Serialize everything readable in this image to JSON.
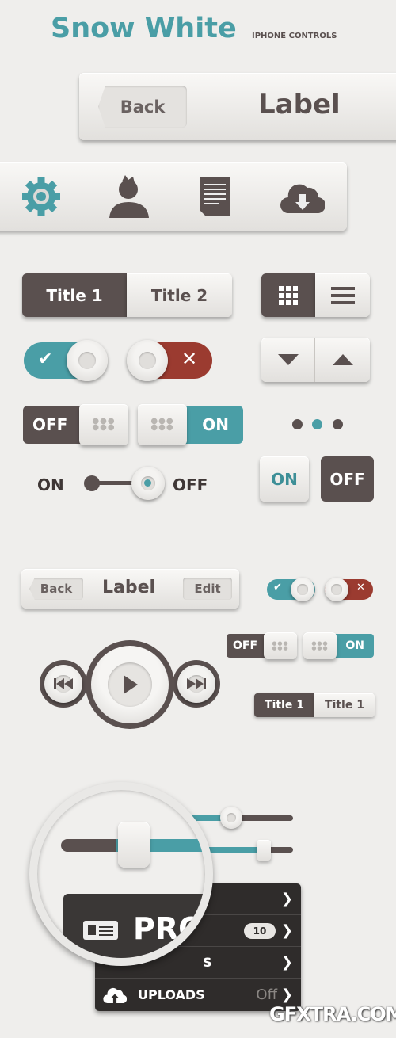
{
  "header": {
    "title": "Snow White",
    "subtitle": "IPHONE CONTROLS"
  },
  "colors": {
    "accent": "#4a9ea6",
    "dark": "#5a504f",
    "danger": "#9b3b30",
    "background": "#efeeec"
  },
  "navbar": {
    "back": "Back",
    "label": "Label"
  },
  "tabbar": {
    "icons": [
      "gear-icon",
      "user-icon",
      "document-icon",
      "cloud-download-icon"
    ]
  },
  "segmented": {
    "items": [
      "Title 1",
      "Title 2"
    ],
    "selected": 0
  },
  "view_toggle": {
    "icons": [
      "grid-icon",
      "list-icon"
    ],
    "selected": 0
  },
  "switches": {
    "off": "OFF",
    "on": "ON"
  },
  "page_dots": {
    "count": 3,
    "active": 1
  },
  "slider_switch": {
    "left": "ON",
    "right": "OFF"
  },
  "onoff_buttons": {
    "on": "ON",
    "off": "OFF"
  },
  "small_navbar": {
    "back": "Back",
    "label": "Label",
    "edit": "Edit"
  },
  "small_segmented": {
    "items": [
      "Title 1",
      "Title 1"
    ]
  },
  "sliders": {
    "values": [
      45,
      88
    ]
  },
  "magnifier": {
    "label": "PRO"
  },
  "menu": {
    "rows": [
      {
        "label": ""
      },
      {
        "label": "",
        "badge": "10"
      },
      {
        "label": "S"
      },
      {
        "label": "UPLOADS",
        "value": "Off"
      }
    ]
  },
  "watermark": "GFXTRA.COM"
}
